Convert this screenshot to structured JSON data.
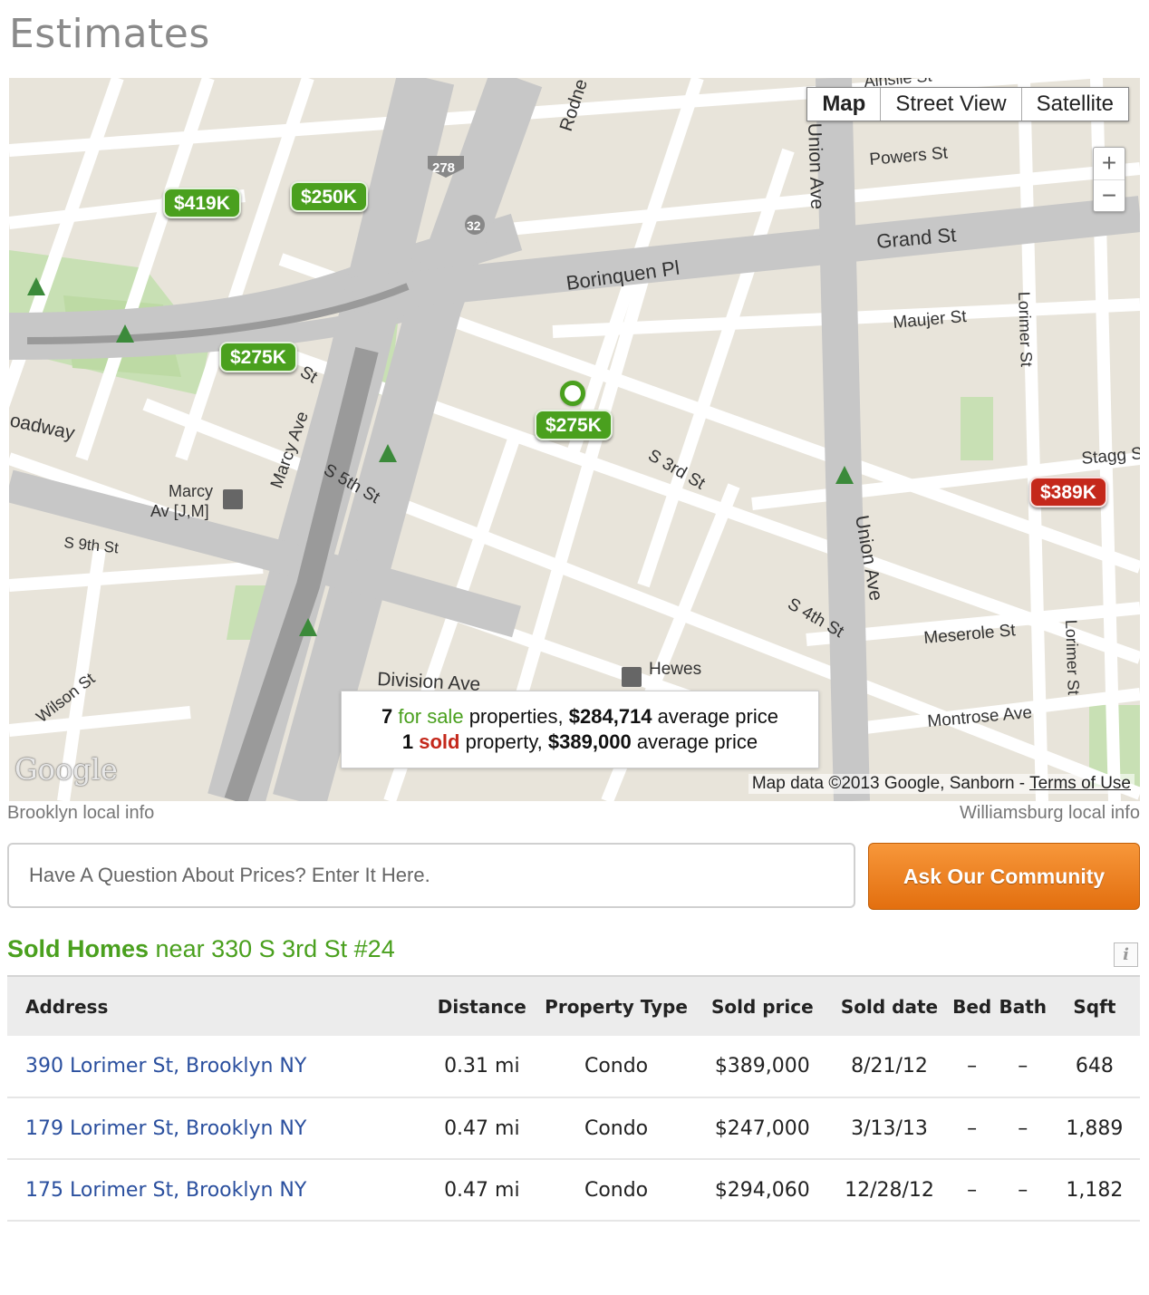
{
  "page_title": "Estimates",
  "map": {
    "type_buttons": [
      "Map",
      "Street View",
      "Satellite"
    ],
    "zoom_in": "+",
    "zoom_out": "−",
    "markers": {
      "m1": "$419K",
      "m2": "$250K",
      "m3": "$275K",
      "m4": "$275K",
      "m5": "$389K"
    },
    "marker_colors": {
      "for_sale": "#4aa01e",
      "sold": "#c4281b"
    },
    "streets": {
      "powers": "Powers St",
      "grand": "Grand St",
      "borinquen": "Borinquen Pl",
      "maujer": "Maujer St",
      "lorimer1": "Lorimer St",
      "lorimer2": "Lorimer St",
      "stagg": "Stagg St",
      "union1": "Union Ave",
      "union2": "Union Ave",
      "s3rd": "S 3rd St",
      "s4th": "S 4th St",
      "s5th": "S 5th St",
      "s9th": "S 9th St",
      "marcy_ave": "Marcy Ave",
      "marcy_station_1": "Marcy",
      "marcy_station_2": "Av [J,M]",
      "hewes_1": "Hewes",
      "meserole": "Meserole St",
      "montrose": "Montrose Ave",
      "division": "Division Ave",
      "wilson": "Wilson St",
      "broadway": "oadway",
      "rodney": "Rodne",
      "hwy278": "278",
      "hwy32": "32",
      "st_frag": "St",
      "ainslie": "Ainslie St"
    },
    "summary": {
      "line1_count": "7",
      "line1_word": "for sale",
      "line1_mid": "properties,",
      "line1_price": "$284,714",
      "line1_tail": "average price",
      "line2_count": "1",
      "line2_word": "sold",
      "line2_mid": "property,",
      "line2_price": "$389,000",
      "line2_tail": "average price"
    },
    "logo": "Google",
    "attribution": "Map data ©2013 Google, Sanborn - ",
    "terms_link": "Terms of Use",
    "local_left": "Brooklyn local info",
    "local_right": "Williamsburg local info"
  },
  "question": {
    "placeholder": "Have A Question About Prices? Enter It Here.",
    "button": "Ask Our Community"
  },
  "sold_section": {
    "title_strong": "Sold Homes",
    "title_rest": " near 330 S 3rd St #24",
    "info_icon": "i",
    "headers": [
      "Address",
      "Distance",
      "Property Type",
      "Sold price",
      "Sold date",
      "Bed",
      "Bath",
      "Sqft"
    ],
    "rows": [
      [
        "390 Lorimer St, Brooklyn NY",
        "0.31 mi",
        "Condo",
        "$389,000",
        "8/21/12",
        "–",
        "–",
        "648"
      ],
      [
        "179 Lorimer St, Brooklyn NY",
        "0.47 mi",
        "Condo",
        "$247,000",
        "3/13/13",
        "–",
        "–",
        "1,889"
      ],
      [
        "175 Lorimer St, Brooklyn NY",
        "0.47 mi",
        "Condo",
        "$294,060",
        "12/28/12",
        "–",
        "–",
        "1,182"
      ]
    ]
  }
}
